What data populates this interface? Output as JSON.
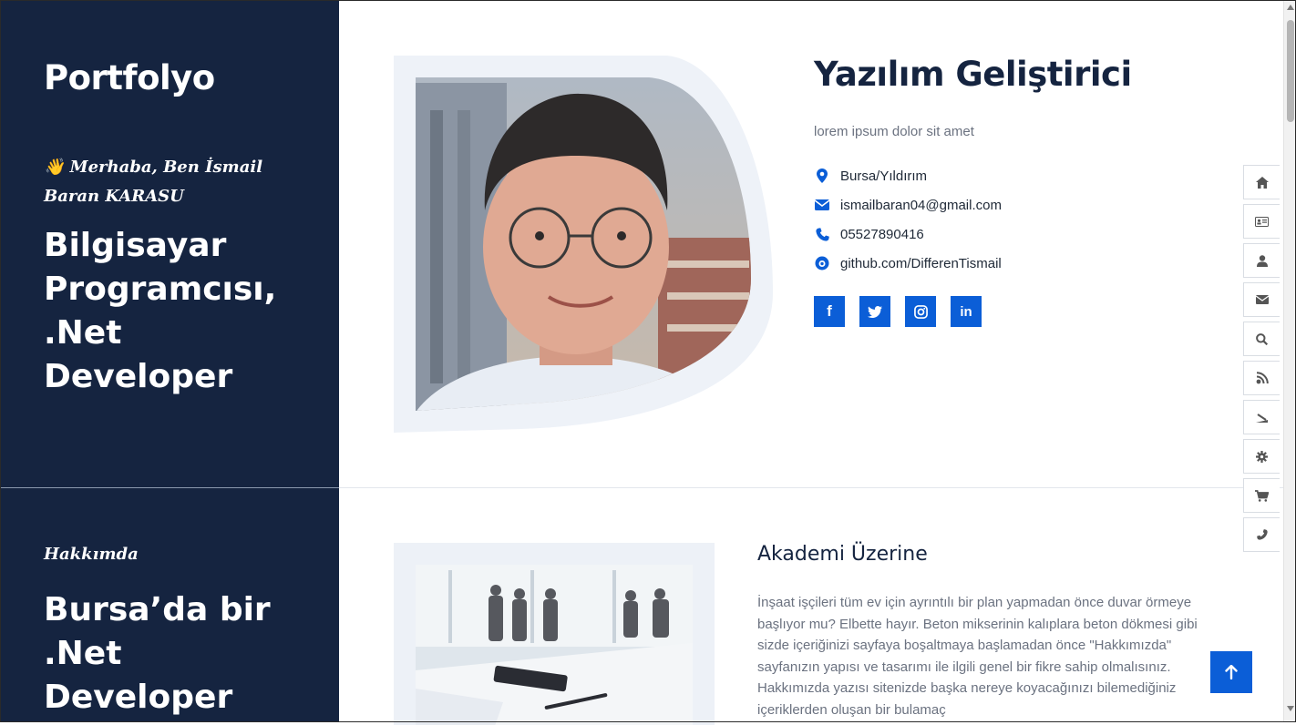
{
  "left": {
    "brand": "Portfolyo",
    "greeting": "👋 Merhaba, Ben İsmail Baran KARASU",
    "role": "Bilgisayar Programcısı, .Net Developer",
    "about_kicker": "Hakkımda",
    "about_title": "Bursa’da bir .Net Developer"
  },
  "profile": {
    "name": "Yazılım Geliştirici",
    "subtitle": "lorem ipsum dolor sit amet",
    "location": "Bursa/Yıldırım",
    "email": "ismailbaran04@gmail.com",
    "phone": "05527890416",
    "github": "github.com/DifferenTismail"
  },
  "socials": [
    {
      "icon": "facebook-icon"
    },
    {
      "icon": "twitter-icon"
    },
    {
      "icon": "instagram-icon"
    },
    {
      "icon": "linkedin-icon"
    }
  ],
  "about": {
    "heading": "Akademi Üzerine",
    "text": "İnşaat işçileri tüm ev için ayrıntılı bir plan yapmadan önce duvar örmeye başlıyor mu? Elbette hayır. Beton mikserinin kalıplara beton dökmesi gibi sizde içeriğinizi sayfaya boşaltmaya başlamadan önce \"Hakkımızda\" sayfanızın yapısı ve tasarımı ile ilgili genel bir fikre sahip olmalısınız. Hakkımızda yazısı sitenizde başka nereye koyacağınızı bilemediğiniz içeriklerden oluşan bir bulamaç"
  },
  "side_nav": [
    "home-icon",
    "id-card-icon",
    "user-icon",
    "envelope-icon",
    "search-icon",
    "blog-icon",
    "rss-icon",
    "gear-icon",
    "cart-icon",
    "phone-icon"
  ],
  "colors": {
    "dark": "#152440",
    "accent": "#0b5ed7",
    "muted": "#6b7280"
  }
}
